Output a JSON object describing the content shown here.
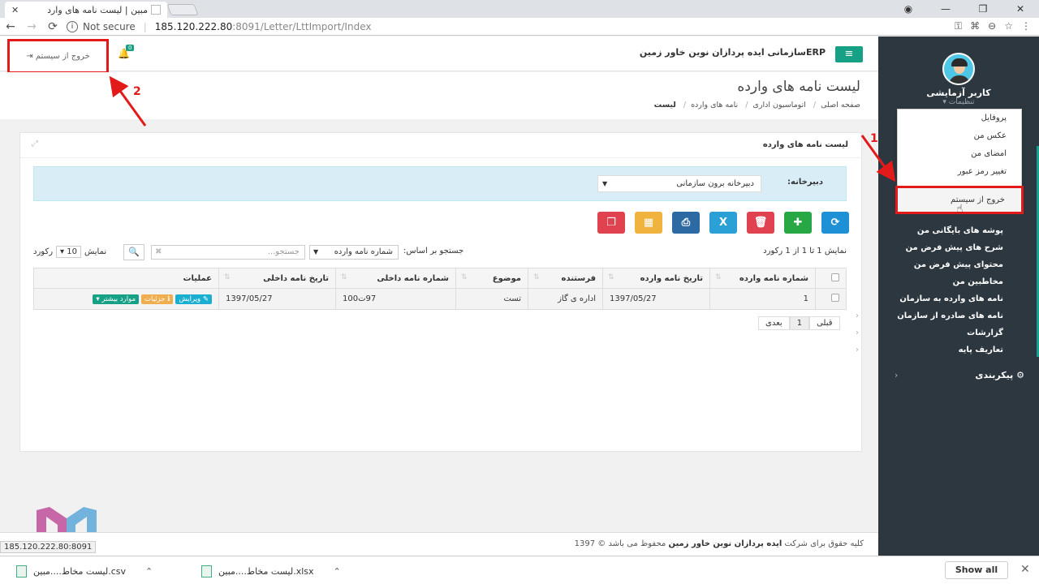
{
  "browser": {
    "tab_title": "مبین | لیست نامه های وارد",
    "tab_close": "✕",
    "url_secure_label": "Not secure",
    "url_host": "185.120.222.80",
    "url_path": ":8091/Letter/LttImport/Index",
    "status_url": "185.120.222.80:8091"
  },
  "header": {
    "app_title": "ERPسازمانی ایده پردازان نوین خاور زمین",
    "notif_count": "0",
    "logout_label": "خروج از سیستم"
  },
  "page": {
    "title": "لیست نامه های وارده",
    "breadcrumb": [
      "صفحه اصلی",
      "اتوماسیون اداری",
      "نامه های وارده",
      "لیست"
    ]
  },
  "card": {
    "title": "لیست نامه های وارده",
    "filter_label": "دبیرخانه:",
    "filter_value": "دبیرخانه برون سازمانی"
  },
  "toolbar": {
    "buttons": [
      {
        "name": "refresh",
        "icon": "⟳",
        "color": "#1e90d6"
      },
      {
        "name": "add",
        "icon": "✚",
        "color": "#28a745"
      },
      {
        "name": "delete",
        "icon": "🗑",
        "color": "#e0434f"
      },
      {
        "name": "excel",
        "icon": "X",
        "color": "#2aa0d6"
      },
      {
        "name": "print",
        "icon": "⎙",
        "color": "#2d6aa3"
      },
      {
        "name": "columns",
        "icon": "▦",
        "color": "#f0b33d"
      },
      {
        "name": "copy",
        "icon": "❐",
        "color": "#e0434f"
      }
    ]
  },
  "controls": {
    "info": "نمایش 1 تا 1 از 1 رکورد",
    "search_by_label": "جستجو بر اساس:",
    "search_by_value": "شماره نامه وارده",
    "search_placeholder": "جستجو...",
    "show_label": "نمایش",
    "page_size": "10",
    "records_label": "رکورد"
  },
  "table": {
    "headers": [
      "شماره نامه وارده",
      "تاریخ نامه وارده",
      "فرستنده",
      "موضوع",
      "شماره نامه داخلی",
      "تاریخ نامه داخلی",
      "عملیات"
    ],
    "rows": [
      {
        "number": "1",
        "date": "1397/05/27",
        "sender": "اداره ی گاز",
        "subject": "تست",
        "internal_no": "97ت100",
        "internal_date": "1397/05/27"
      }
    ],
    "actions": {
      "edit": "ویرایش",
      "details": "جزئیات",
      "more": "موارد بیشتر"
    }
  },
  "pager": {
    "prev": "قبلی",
    "current": "1",
    "next": "بعدی"
  },
  "footer": {
    "prefix": "کلیه حقوق برای شرکت",
    "company": "ایده پردازان نوین خاور زمین",
    "suffix": "محفوظ می باشد © 1397"
  },
  "sidebar": {
    "user_name": "کاربر آزمایشی",
    "settings_label": "تنظیمات",
    "profile_menu": [
      "پروفایل",
      "عکس من",
      "امضای من",
      "تغییر رمز عبور"
    ],
    "logout": "خروج از سیستم",
    "items": [
      {
        "label": "پوشه های بایگانی من",
        "chevron": false
      },
      {
        "label": "شرح های پیش فرض من",
        "chevron": false
      },
      {
        "label": "محتوای پیش فرض من",
        "chevron": false
      },
      {
        "label": "مخاطبین من",
        "chevron": false
      },
      {
        "label": "نامه های وارده به سازمان",
        "chevron": false
      },
      {
        "label": "نامه های صادره از سازمان",
        "chevron": true
      },
      {
        "label": "گزارشات",
        "chevron": true
      },
      {
        "label": "تعاریف پایه",
        "chevron": true
      }
    ],
    "config": "پیکربندی"
  },
  "annotations": [
    "1",
    "2"
  ],
  "downloads": [
    {
      "name": "لیست مخاط....مبین.csv"
    },
    {
      "name": "لیست مخاط....مبین.xlsx"
    }
  ],
  "downloads_show_all": "Show all",
  "colors": {
    "accent": "#16a085",
    "sidebar": "#2d373f",
    "highlight": "#e21a1a"
  }
}
